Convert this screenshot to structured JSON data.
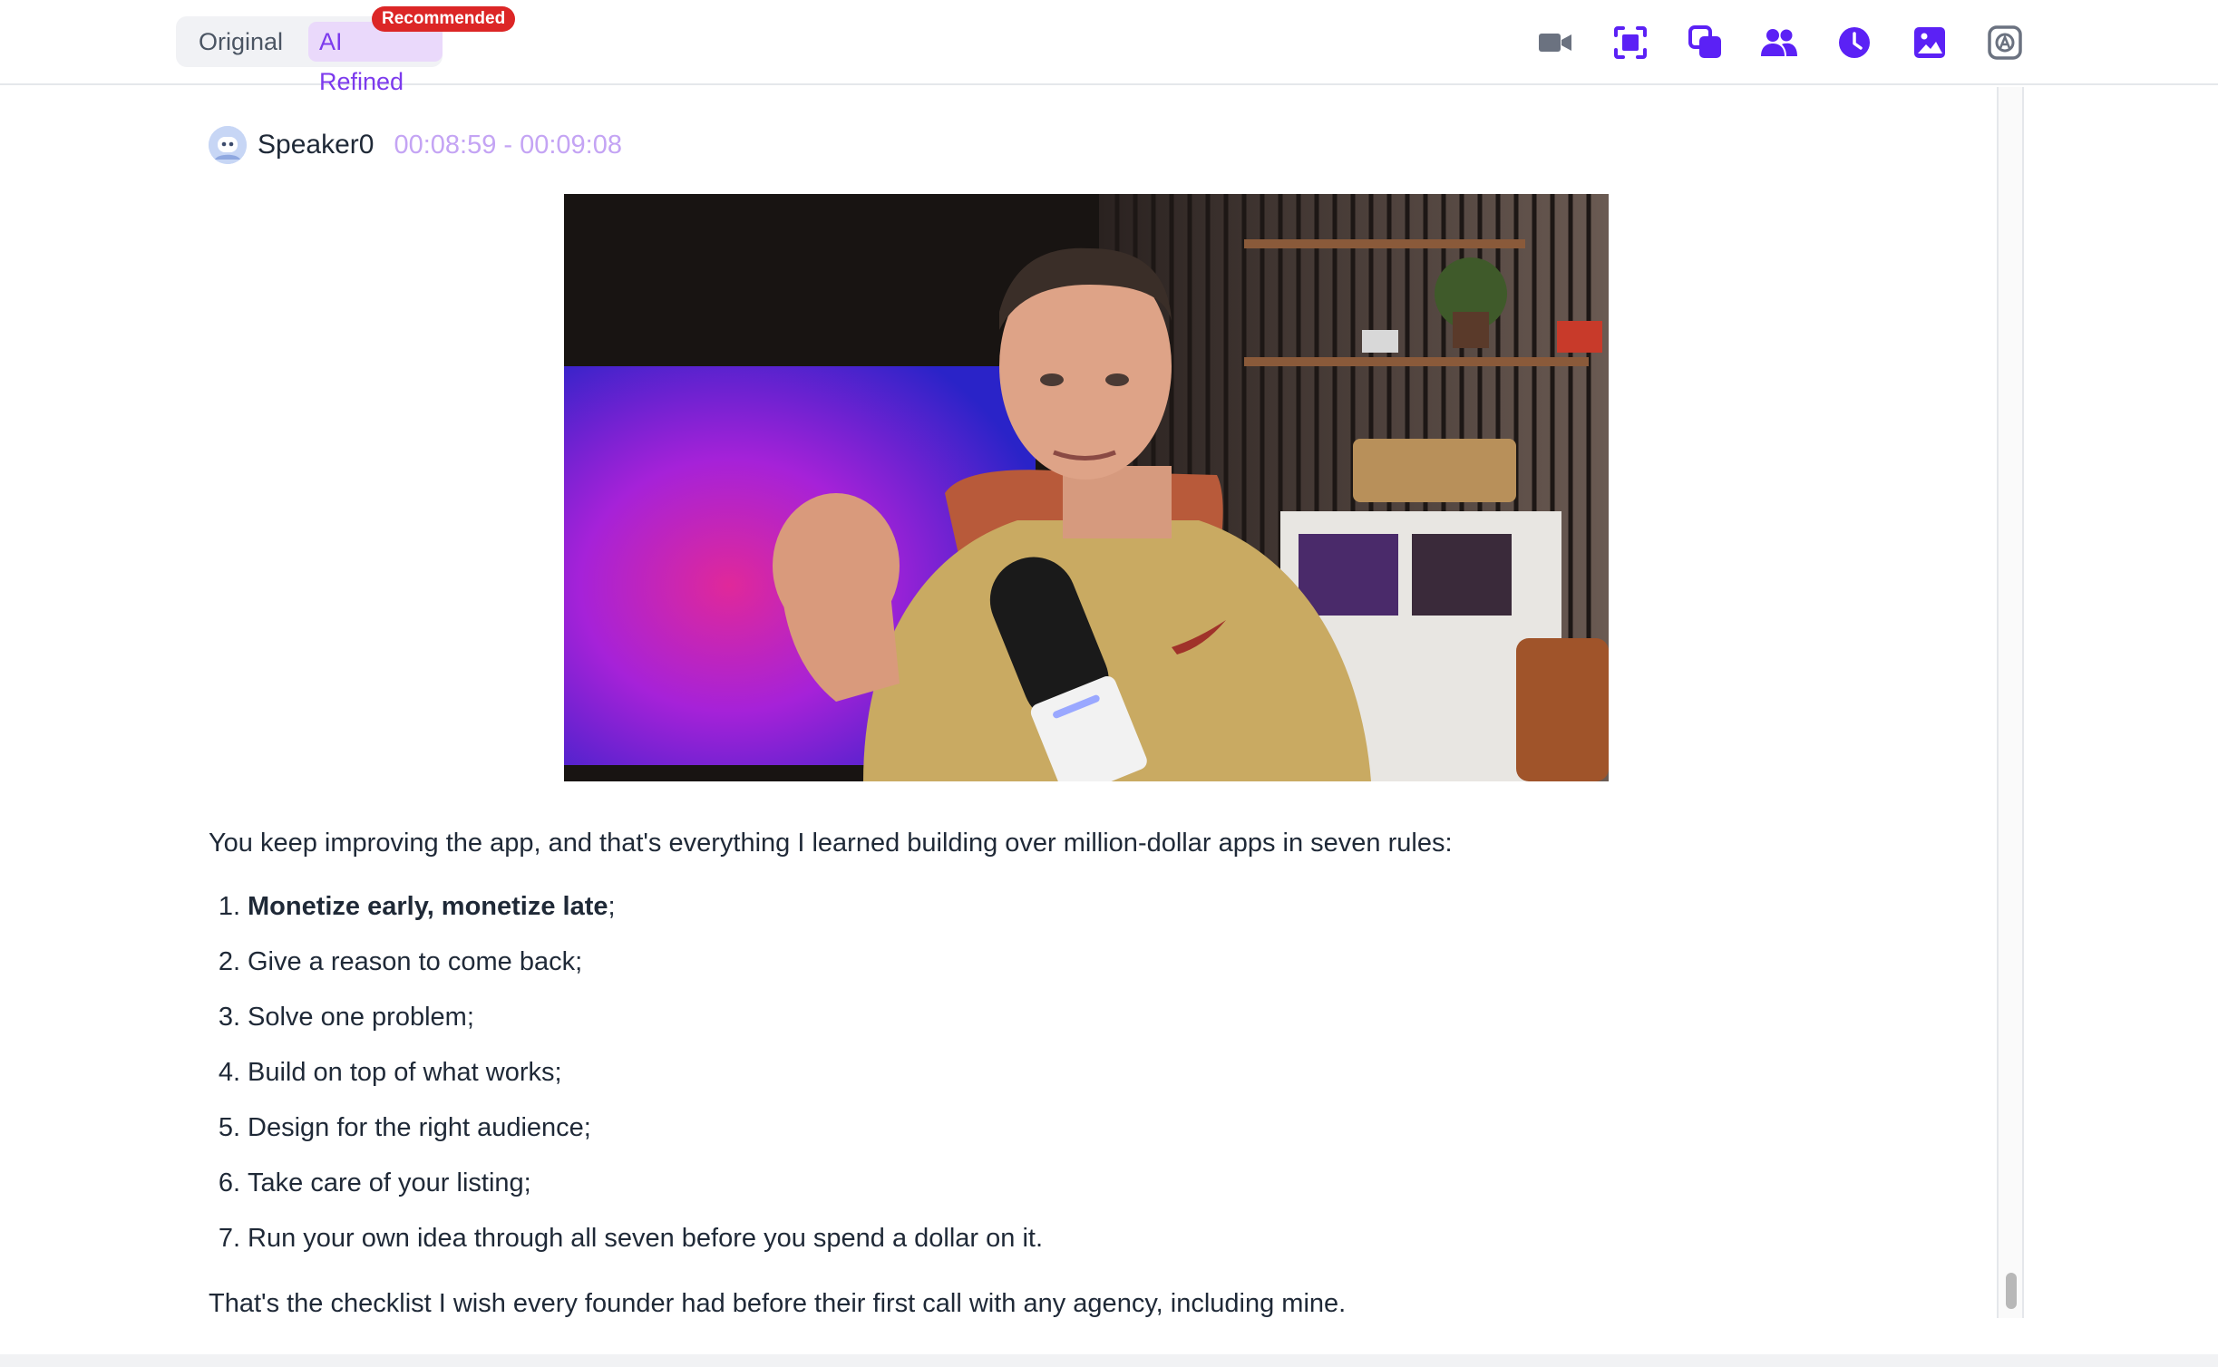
{
  "header": {
    "view_toggle": {
      "original_label": "Original",
      "refined_label": "AI Refined",
      "selected": "AI Refined",
      "recommended_badge": "Recommended"
    },
    "tools": [
      {
        "icon": "video-camera-icon",
        "color": "#6b7280"
      },
      {
        "icon": "screenshot-icon",
        "color": "#5b21f5"
      },
      {
        "icon": "copy-pages-icon",
        "color": "#5b21f5"
      },
      {
        "icon": "users-icon",
        "color": "#5b21f5"
      },
      {
        "icon": "clock-icon",
        "color": "#5b21f5"
      },
      {
        "icon": "image-icon",
        "color": "#5b21f5"
      },
      {
        "icon": "ai-settings-icon",
        "color": "#6b7280"
      }
    ]
  },
  "segment": {
    "speaker": "Speaker0",
    "timestamp": "00:08:59 - 00:09:08",
    "intro": "You keep improving the app, and that's everything I learned building over million-dollar apps in seven rules:",
    "rules": [
      {
        "num": "1.",
        "bold": "Monetize early, monetize late",
        "text": ";"
      },
      {
        "num": "2.",
        "bold": "",
        "text": "Give a reason to come back;"
      },
      {
        "num": "3.",
        "bold": "",
        "text": "Solve one problem;"
      },
      {
        "num": "4.",
        "bold": "",
        "text": "Build on top of what works;"
      },
      {
        "num": "5.",
        "bold": "",
        "text": "Design for the right audience;"
      },
      {
        "num": "6.",
        "bold": "",
        "text": "Take care of your listing;"
      },
      {
        "num": "7.",
        "bold": "",
        "text": "Run your own idea through all seven before you spend a dollar on it."
      }
    ],
    "outro": "That's the checklist I wish every founder had before their first call with any agency, including mine."
  },
  "colors": {
    "accent": "#7c3aed",
    "accent_bg": "#ead9fb",
    "timestamp": "#c4a4f4",
    "badge": "#dc2626",
    "icon_primary": "#5b21f5"
  }
}
